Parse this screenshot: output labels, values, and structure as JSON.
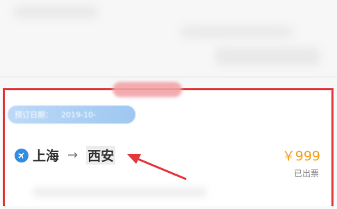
{
  "order": {
    "date_label": "预订日期：",
    "date_value": "2019-10-",
    "from_city": "上海",
    "arrow": "→",
    "to_city": "西安",
    "price": "￥999",
    "status": "已出票"
  },
  "colors": {
    "highlight_border": "#e4383d",
    "pointer_arrow": "#e4383d",
    "price": "#f5a11c",
    "date_pill": "#9ec7f1",
    "plane_icon": "#2f8de4"
  },
  "icons": {
    "plane": "airplane-icon"
  }
}
